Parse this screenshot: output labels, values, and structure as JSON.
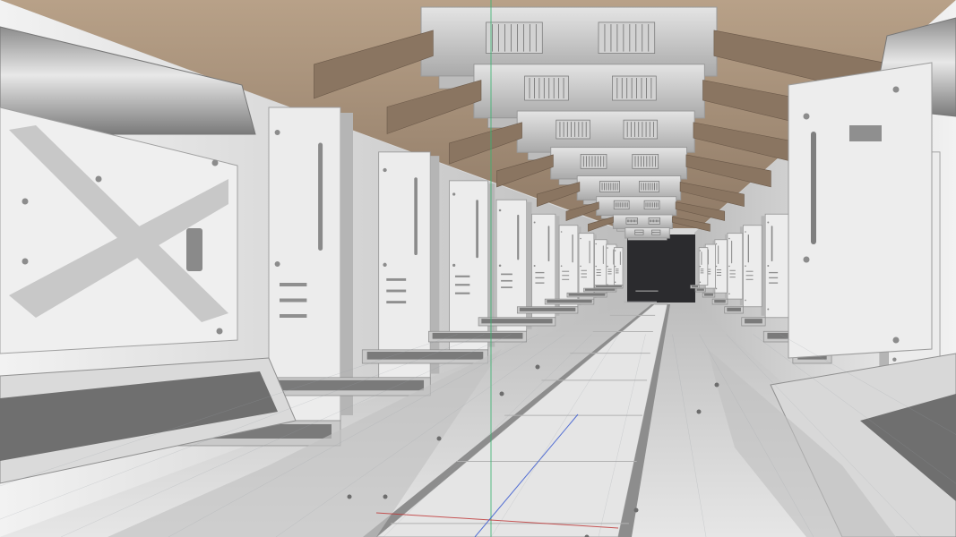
{
  "viewport": {
    "kind": "3d-render-viewport",
    "scene": "sci-fi-corridor",
    "floor_grid": true,
    "axis_colors": {
      "x": "#c03a3a",
      "y": "#3cb371",
      "z": "#3a5ad0"
    }
  },
  "palette": {
    "panel": "#e9e9e9",
    "panel_shadow": "#9a9a9a",
    "panel_dark": "#6e6e6e",
    "ceiling_warm": "#b49a80",
    "duct": "#cfcfcf",
    "floor": "#dcdcdc",
    "floor_strip": "#8d8d8d",
    "void": "#2b2b2e"
  },
  "icons": {
    "vent_grille": "vent-grille-icon",
    "door_handle": "door-handle-icon",
    "rivet": "rivet-icon"
  }
}
